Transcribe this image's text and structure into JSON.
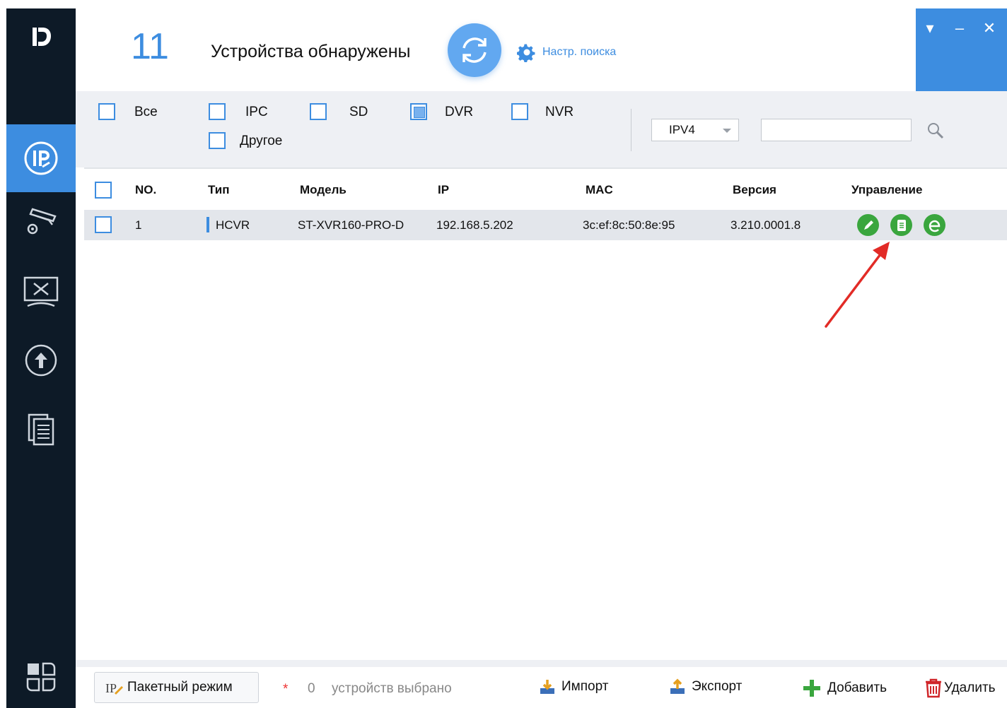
{
  "header": {
    "device_count": "11",
    "found_label": "Устройства обнаружены",
    "search_settings_label": "Настр. поиска"
  },
  "window_controls": {
    "menu_glyph": "▾",
    "minimize_glyph": "–",
    "close_glyph": "✕"
  },
  "sidebar": {
    "logo_text": "Ⅳ",
    "items": [
      {
        "icon": "ip-icon",
        "active": true
      },
      {
        "icon": "camera-settings-icon",
        "active": false
      },
      {
        "icon": "system-tools-icon",
        "active": false
      },
      {
        "icon": "upgrade-icon",
        "active": false
      },
      {
        "icon": "documents-icon",
        "active": false
      },
      {
        "icon": "apps-icon",
        "active": false
      }
    ]
  },
  "filters": {
    "all_label": "Все",
    "ipc_label": "IPC",
    "sd_label": "SD",
    "dvr_label": "DVR",
    "nvr_label": "NVR",
    "other_label": "Другое",
    "dvr_checked": true,
    "ip_version": "IPV4",
    "search_value": ""
  },
  "table": {
    "columns": [
      "NO.",
      "Тип",
      "Модель",
      "IP",
      "MAC",
      "Версия",
      "Управление"
    ],
    "rows": [
      {
        "no": "1",
        "type": "HCVR",
        "model": "ST-XVR160-PRO-D",
        "ip": "192.168.5.202",
        "mac": "3c:ef:8c:50:8e:95",
        "version": "3.210.0001.8",
        "actions": [
          "edit-icon",
          "details-icon",
          "web-icon"
        ]
      }
    ]
  },
  "footer": {
    "batch_mode_label": "Пакетный режим",
    "asterisk": "*",
    "selected_count": "0",
    "selected_text": "устройств выбрано",
    "import_label": "Импорт",
    "export_label": "Экспорт",
    "add_label": "Добавить",
    "delete_label": "Удалить"
  },
  "colors": {
    "accent": "#3d8de0",
    "sidebar_bg": "#0d1a27",
    "action_green": "#3aa63e",
    "annotation_red": "#e22b26"
  }
}
